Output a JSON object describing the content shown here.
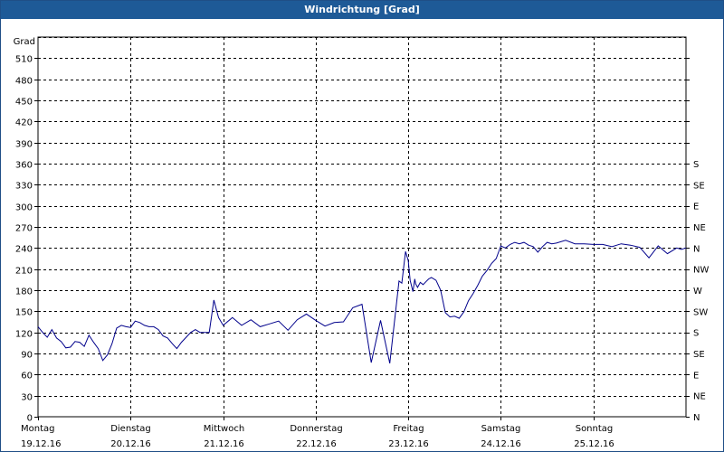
{
  "window": {
    "title": "Windrichtung [Grad]"
  },
  "colors": {
    "titlebar": "#1e5a97",
    "series": "#00008b",
    "grid": "#000000"
  },
  "chart_data": {
    "type": "line",
    "title": "Windrichtung [Grad]",
    "ylabel": "Grad",
    "ylim": [
      0,
      540
    ],
    "yticks": [
      0,
      30,
      60,
      90,
      120,
      150,
      180,
      210,
      240,
      270,
      300,
      330,
      360,
      390,
      420,
      450,
      480,
      510
    ],
    "right_axis_labels": [
      "N",
      "NE",
      "E",
      "SE",
      "S",
      "SW",
      "W",
      "NW",
      "N",
      "NE",
      "E",
      "SE",
      "S"
    ],
    "right_axis_values": [
      0,
      30,
      60,
      90,
      120,
      150,
      180,
      210,
      240,
      270,
      300,
      330,
      360,
      390,
      420,
      450,
      480,
      510,
      540
    ],
    "xlim": [
      0,
      7
    ],
    "x_categories": [
      {
        "day": "Montag",
        "date": "19.12.16"
      },
      {
        "day": "Dienstag",
        "date": "20.12.16"
      },
      {
        "day": "Mittwoch",
        "date": "21.12.16"
      },
      {
        "day": "Donnerstag",
        "date": "22.12.16"
      },
      {
        "day": "Freitag",
        "date": "23.12.16"
      },
      {
        "day": "Samstag",
        "date": "24.12.16"
      },
      {
        "day": "Sonntag",
        "date": "25.12.16"
      }
    ],
    "grid": true,
    "series": [
      {
        "x": [
          0,
          0.05,
          0.1,
          0.15,
          0.2,
          0.25,
          0.3,
          0.35,
          0.4,
          0.45,
          0.5,
          0.55,
          0.6,
          0.65,
          0.7,
          0.75,
          0.8,
          0.85,
          0.9,
          0.95,
          1.0,
          1.05,
          1.1,
          1.15,
          1.2,
          1.25,
          1.3,
          1.35,
          1.4,
          1.45,
          1.5,
          1.55,
          1.6,
          1.65,
          1.7,
          1.75,
          1.8,
          1.85,
          1.9,
          1.95,
          2.0,
          2.1,
          2.2,
          2.3,
          2.4,
          2.5,
          2.6,
          2.7,
          2.8,
          2.9,
          3.0,
          3.1,
          3.2,
          3.3,
          3.4,
          3.5,
          3.6,
          3.7,
          3.8,
          3.9,
          3.93,
          3.97,
          4.0,
          4.02,
          4.05,
          4.07,
          4.08,
          4.1,
          4.13,
          4.16,
          4.19,
          4.22,
          4.25,
          4.3,
          4.35,
          4.4,
          4.45,
          4.5,
          4.55,
          4.6,
          4.65,
          4.7,
          4.75,
          4.8,
          4.85,
          4.9,
          4.95,
          5.0,
          5.05,
          5.1,
          5.15,
          5.2,
          5.25,
          5.3,
          5.35,
          5.4,
          5.45,
          5.5,
          5.55,
          5.6,
          5.7,
          5.8,
          5.9,
          6.0,
          6.1,
          6.2,
          6.3,
          6.4,
          6.5,
          6.6,
          6.7,
          6.8,
          6.9,
          6.95,
          7.0
        ],
        "y": [
          128,
          120,
          113,
          124,
          112,
          107,
          98,
          99,
          107,
          106,
          100,
          116,
          106,
          97,
          80,
          88,
          104,
          126,
          130,
          128,
          127,
          136,
          134,
          130,
          128,
          128,
          124,
          115,
          112,
          104,
          97,
          106,
          113,
          120,
          124,
          120,
          120,
          120,
          166,
          141,
          130,
          141,
          130,
          138,
          128,
          132,
          136,
          123,
          138,
          146,
          137,
          129,
          134,
          135,
          155,
          160,
          77,
          137,
          76,
          193,
          190,
          235,
          222,
          194,
          178,
          196,
          189,
          184,
          191,
          188,
          192,
          196,
          198,
          194,
          180,
          148,
          142,
          143,
          140,
          149,
          165,
          175,
          187,
          200,
          208,
          218,
          225,
          243,
          240,
          245,
          248,
          246,
          248,
          244,
          242,
          234,
          242,
          248,
          246,
          247,
          251,
          246,
          246,
          245,
          245,
          242,
          246,
          244,
          241,
          226,
          243,
          232,
          240,
          238,
          240
        ]
      }
    ]
  }
}
